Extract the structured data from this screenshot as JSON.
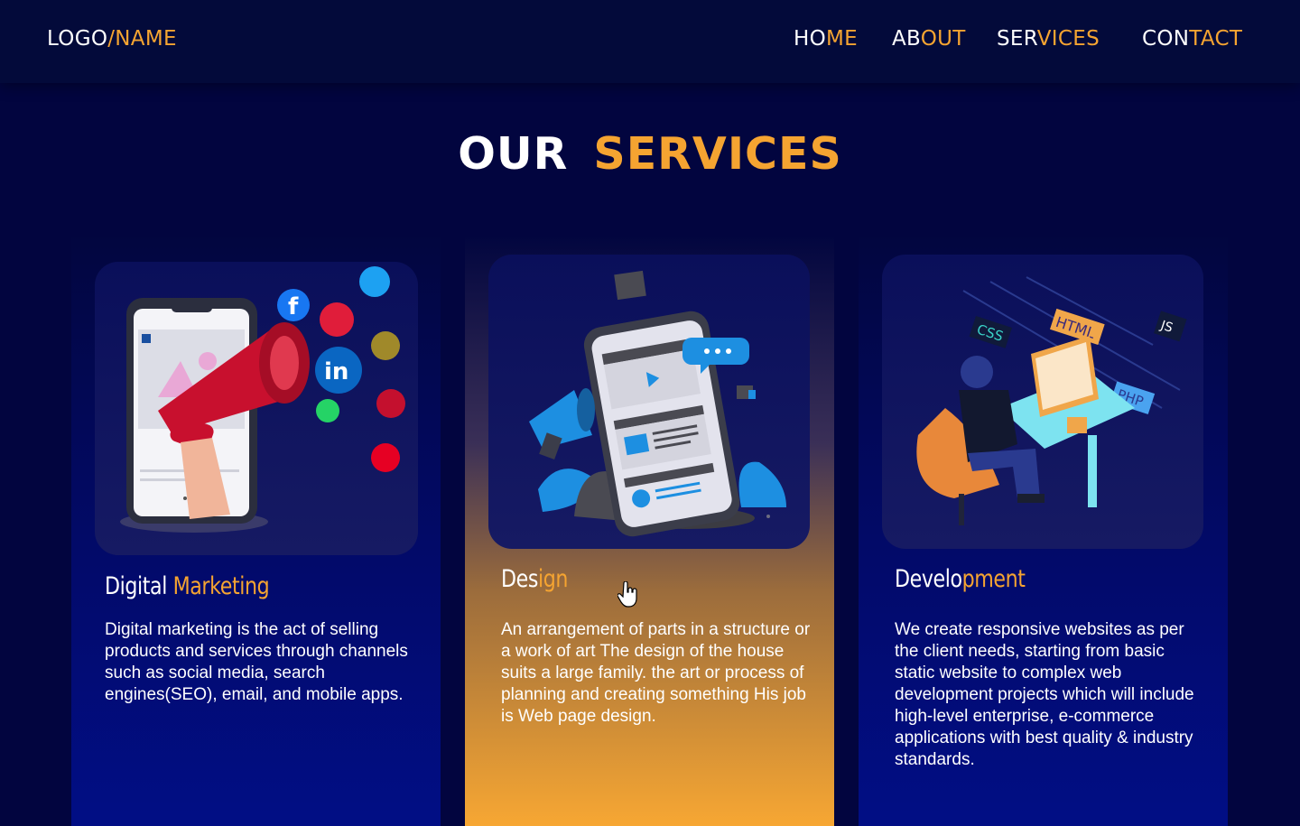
{
  "header": {
    "logo": {
      "part1": "LOGO",
      "part2": "/NAME"
    },
    "nav": [
      {
        "a": "HO",
        "b": "ME"
      },
      {
        "a": "AB",
        "b": "OUT"
      },
      {
        "a": "SER",
        "b": "VICES"
      },
      {
        "a": "CON",
        "b": "TACT"
      }
    ]
  },
  "section": {
    "title_a": "OUR",
    "title_b": "SERVICES"
  },
  "cards": [
    {
      "title_a": "Digital ",
      "title_b": "Marketing",
      "description": "Digital marketing is the act of selling products and services through channels such as social media, search engines(SEO), email, and mobile apps.",
      "image_icon": "megaphone-phone-illustration"
    },
    {
      "title_a": "Des",
      "title_b": "ign",
      "description": "An arrangement of parts in a structure or a work of art The design of the house suits a large family.  the art or process of planning and creating something His job is Web page design.",
      "image_icon": "mobile-design-illustration"
    },
    {
      "title_a": "Develo",
      "title_b": "pment",
      "description": "We create responsive websites as per the client needs, starting from basic static website to complex web development projects which will include high-level enterprise, e-commerce applications with best quality & industry standards.",
      "image_icon": "developer-desk-illustration",
      "tags": [
        "HTML",
        "CSS",
        "JS",
        "PHP"
      ]
    }
  ],
  "colors": {
    "accent": "#f5a431",
    "background": "#02053f",
    "highlight_card": "#f7a733"
  }
}
